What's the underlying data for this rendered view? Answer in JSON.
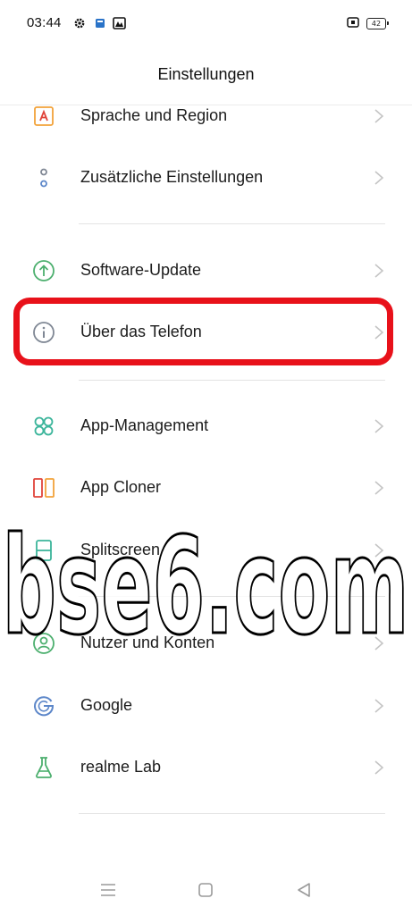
{
  "status_bar": {
    "time": "03:44",
    "battery": "42"
  },
  "header": {
    "title": "Einstellungen"
  },
  "items": [
    {
      "label": "Sprache und Region",
      "icon": "language-icon"
    },
    {
      "label": "Zusätzliche Einstellungen",
      "icon": "more-settings-icon"
    },
    {
      "label": "Software-Update",
      "icon": "software-update-icon"
    },
    {
      "label": "Über das Telefon",
      "icon": "info-icon"
    },
    {
      "label": "App-Management",
      "icon": "app-management-icon"
    },
    {
      "label": "App Cloner",
      "icon": "app-cloner-icon"
    },
    {
      "label": "Splitscreen",
      "icon": "splitscreen-icon"
    },
    {
      "label": "Nutzer und Konten",
      "icon": "user-accounts-icon"
    },
    {
      "label": "Google",
      "icon": "google-icon"
    },
    {
      "label": "realme Lab",
      "icon": "lab-flask-icon"
    }
  ],
  "watermark": {
    "text": "bse6.com"
  },
  "colors": {
    "highlight": "#e8111a",
    "green": "#4caf6e",
    "orange": "#f2a23a",
    "red": "#e0443a",
    "gray_icon": "#8a8f99"
  }
}
